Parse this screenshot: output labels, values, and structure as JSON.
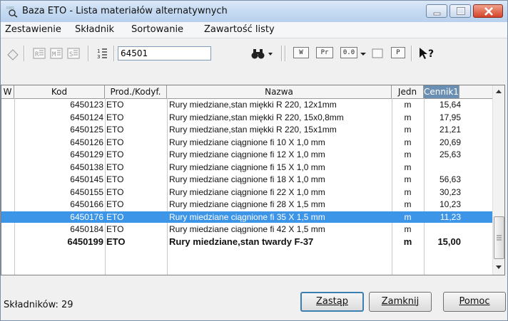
{
  "window": {
    "title": "Baza ETO - Lista materiałów alternatywnych",
    "icon_text": "RMS"
  },
  "menu": [
    "Zestawienie",
    "Składnik",
    "Sortowanie",
    "Zawartość listy"
  ],
  "toolbar": {
    "search_value": "64501",
    "btn_w": "W",
    "btn_pr": "Pr",
    "btn_00": "0.0",
    "btn_p": "P"
  },
  "table": {
    "headers": [
      "W",
      "Kod",
      "Prod./Kodyf.",
      "Nazwa",
      "Jedn",
      "Cennik1"
    ],
    "rows": [
      {
        "kod": "6450123",
        "prod": "ETO",
        "nazwa": "Rury miedziane,stan miękki R 220, 12x1mm",
        "jedn": "m",
        "cena": "15,64"
      },
      {
        "kod": "6450124",
        "prod": "ETO",
        "nazwa": "Rury miedziane,stan miękki R 220, 15x0,8mm",
        "jedn": "m",
        "cena": "17,95"
      },
      {
        "kod": "6450125",
        "prod": "ETO",
        "nazwa": "Rury miedziane,stan miękki R 220, 15x1mm",
        "jedn": "m",
        "cena": "21,21"
      },
      {
        "kod": "6450126",
        "prod": "ETO",
        "nazwa": "Rury miedziane ciągnione fi 10 X 1,0 mm",
        "jedn": "m",
        "cena": "20,69"
      },
      {
        "kod": "6450129",
        "prod": "ETO",
        "nazwa": "Rury miedziane ciągnione fi 12 X 1,0 mm",
        "jedn": "m",
        "cena": "25,63"
      },
      {
        "kod": "6450138",
        "prod": "ETO",
        "nazwa": "Rury miedziane ciągnione fi 15 X 1,0 mm",
        "jedn": "m",
        "cena": ""
      },
      {
        "kod": "6450145",
        "prod": "ETO",
        "nazwa": "Rury miedziane ciągnione fi 18 X 1,0 mm",
        "jedn": "m",
        "cena": "56,63"
      },
      {
        "kod": "6450155",
        "prod": "ETO",
        "nazwa": "Rury miedziane ciągnione fi 22 X 1,0 mm",
        "jedn": "m",
        "cena": "30,23"
      },
      {
        "kod": "6450166",
        "prod": "ETO",
        "nazwa": "Rury miedziane ciągnione fi 28 X 1,5 mm",
        "jedn": "m",
        "cena": "10,23"
      },
      {
        "kod": "6450176",
        "prod": "ETO",
        "nazwa": "Rury miedziane ciągnione fi 35 X 1,5 mm",
        "jedn": "m",
        "cena": "11,23"
      },
      {
        "kod": "6450184",
        "prod": "ETO",
        "nazwa": "Rury miedziane ciągnione fi 42 X 1,5 mm",
        "jedn": "m",
        "cena": ""
      },
      {
        "kod": "6450199",
        "prod": "ETO",
        "nazwa": "Rury miedziane,stan twardy F-37",
        "jedn": "m",
        "cena": "15,00"
      }
    ]
  },
  "status": {
    "count_text": "Składników: 29"
  },
  "buttons": {
    "zastap": "Zastąp",
    "zamknij": "Zamknij",
    "pomoc": "Pomoc"
  },
  "colors": {
    "selection": "#3d95e8",
    "title_bar": "#c7dbf2",
    "close_button": "#d5432a"
  }
}
